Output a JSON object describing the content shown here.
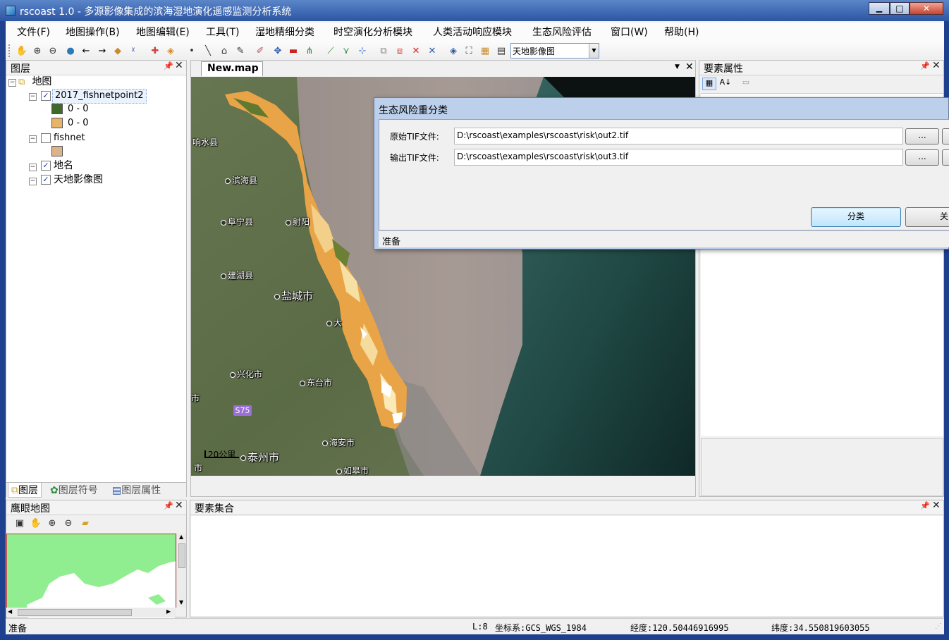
{
  "window": {
    "title": "rscoast 1.0 - 多源影像集成的滨海湿地演化遥感监测分析系统",
    "minimize": "▁",
    "maximize": "□",
    "close": "✕"
  },
  "menu": [
    {
      "label": "文件(F)"
    },
    {
      "label": "地图操作(B)"
    },
    {
      "label": "地图编辑(E)"
    },
    {
      "label": "工具(T)"
    },
    {
      "label": "湿地精细分类"
    },
    {
      "label": "时空演化分析模块"
    },
    {
      "label": "人类活动响应模块"
    },
    {
      "label": "生态风险评估"
    },
    {
      "label": "窗口(W)"
    },
    {
      "label": "帮助(H)"
    }
  ],
  "toolbar": {
    "basemap_select": "天地影像图",
    "icons": [
      "pan-hand",
      "zoom-in",
      "zoom-out",
      "full-extent",
      "back-arrow",
      "forward-arrow",
      "select-feature",
      "clear-select",
      "add-data",
      "remove-data",
      "point",
      "line",
      "polygon",
      "edit",
      "pencil",
      "move",
      "delete",
      "node-edit",
      "line-tool",
      "split",
      "snap",
      "copy",
      "paste",
      "cut",
      "cancel",
      "identify",
      "find",
      "measure",
      "table"
    ]
  },
  "layers_panel": {
    "title": "图层",
    "root": "地图",
    "layers": [
      {
        "name": "2017_fishnetpoint2",
        "checked": true,
        "legend": [
          {
            "label": "0 - 0",
            "color": "#3f6a2a"
          },
          {
            "label": "0 - 0",
            "color": "#e8b46a"
          }
        ]
      },
      {
        "name": "fishnet",
        "checked": false,
        "legend": [
          {
            "label": "",
            "color": "#dcb48c"
          }
        ]
      },
      {
        "name": "地名",
        "checked": true
      },
      {
        "name": "天地影像图",
        "checked": true
      }
    ],
    "tabs": [
      "图层",
      "图层符号",
      "图层属性"
    ]
  },
  "map": {
    "tab_title": "New.map",
    "labels": [
      "响水县",
      "滨海县",
      "阜宁县",
      "射阳",
      "建湖县",
      "盐城市",
      "大",
      "兴化市",
      "东台市",
      "海安市",
      "泰州市",
      "如皋市",
      "S75",
      "市",
      "市"
    ],
    "scale": "20公里"
  },
  "props_panel": {
    "title": "要素属性"
  },
  "dialog": {
    "title": "生态风险重分类",
    "input_label": "原始TIF文件:",
    "input_value": "D:\\rscoast\\examples\\rscoast\\risk\\out2.tif",
    "output_label": "输出TIF文件:",
    "output_value": "D:\\rscoast\\examples\\rscoast\\risk\\out3.tif",
    "browse": "...",
    "classify": "分类",
    "close": "关闭",
    "status": "准备"
  },
  "overview": {
    "title": "鹰眼地图"
  },
  "features": {
    "title": "要素集合"
  },
  "statusbar": {
    "left": "准备",
    "level": "L:8",
    "crs": "坐标系:GCS_WGS_1984",
    "lon": "经度:120.50446916995",
    "lat": "纬度:34.550819603055"
  },
  "colors": {
    "accent": "#1f3f8f",
    "selection_border": "#7aa7e0"
  }
}
